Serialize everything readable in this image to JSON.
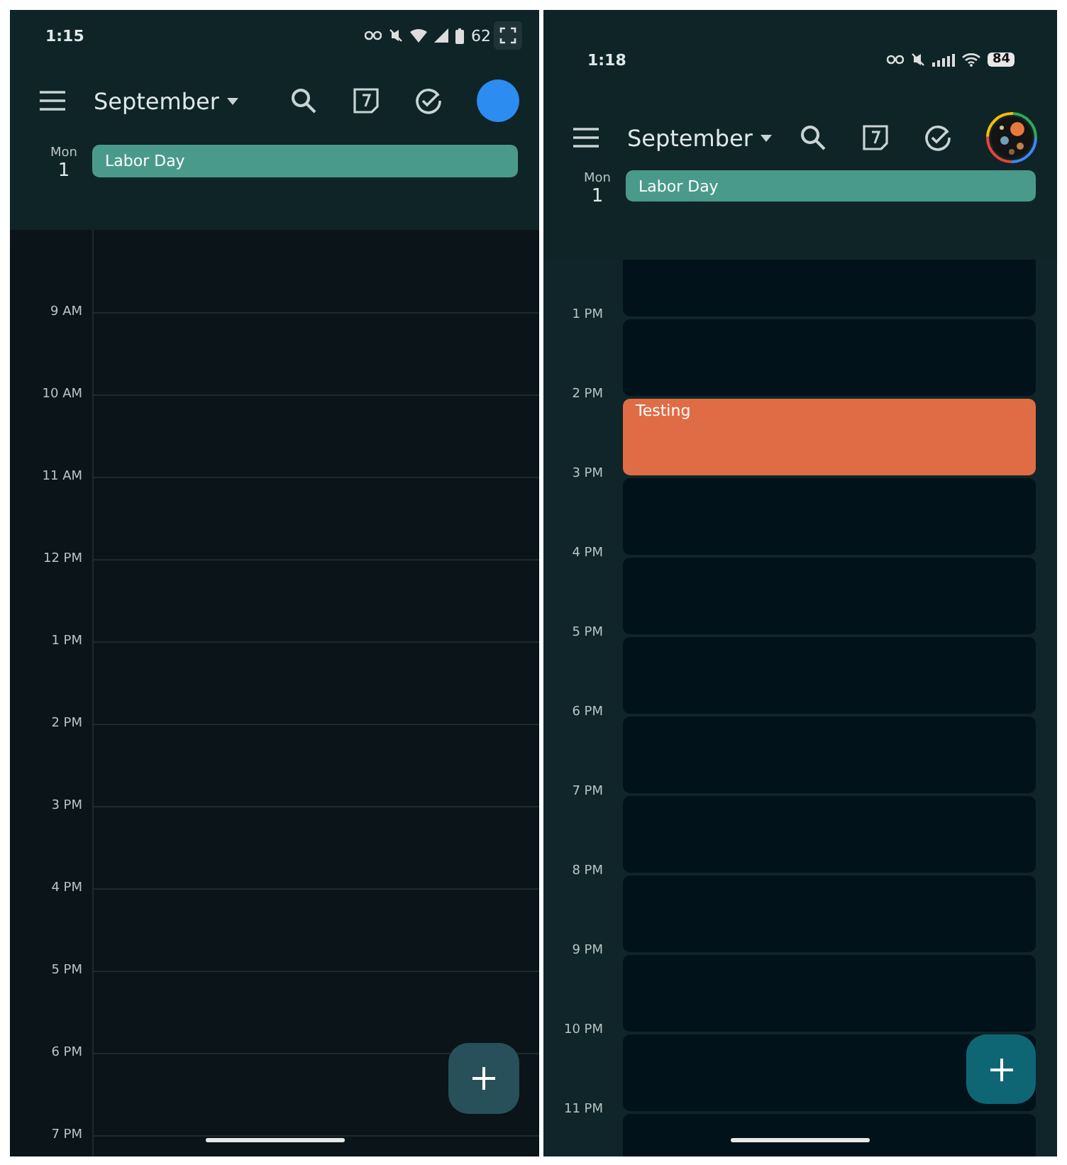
{
  "panels": [
    {
      "kind": "lines",
      "status": {
        "time": "1:15",
        "battery": "62"
      },
      "header": {
        "month": "September",
        "avatar": {
          "kind": "plain",
          "color": "#2d8cf0"
        }
      },
      "all_day": {
        "weekday": "Mon",
        "day": "1",
        "events": [
          {
            "title": "Labor Day",
            "color": "#4a9a8c"
          }
        ]
      },
      "hours": [
        {
          "label": "9 AM"
        },
        {
          "label": "10 AM"
        },
        {
          "label": "11 AM"
        },
        {
          "label": "12 PM"
        },
        {
          "label": "1 PM"
        },
        {
          "label": "2 PM"
        },
        {
          "label": "3 PM"
        },
        {
          "label": "4 PM"
        },
        {
          "label": "5 PM"
        },
        {
          "label": "6 PM"
        },
        {
          "label": "7 PM"
        }
      ]
    },
    {
      "kind": "blocks",
      "status": {
        "time": "1:18",
        "battery": "84"
      },
      "header": {
        "month": "September"
      },
      "all_day": {
        "weekday": "Mon",
        "day": "1",
        "events": [
          {
            "title": "Labor Day",
            "color": "#4a9a8c"
          }
        ]
      },
      "hours": [
        {
          "label": "1 PM"
        },
        {
          "label": "2 PM",
          "events": [
            {
              "title": "Testing",
              "color": "#e06c45"
            }
          ]
        },
        {
          "label": "3 PM"
        },
        {
          "label": "4 PM"
        },
        {
          "label": "5 PM"
        },
        {
          "label": "6 PM"
        },
        {
          "label": "7 PM"
        },
        {
          "label": "8 PM"
        },
        {
          "label": "9 PM"
        },
        {
          "label": "10 PM"
        },
        {
          "label": "11 PM"
        }
      ]
    }
  ]
}
